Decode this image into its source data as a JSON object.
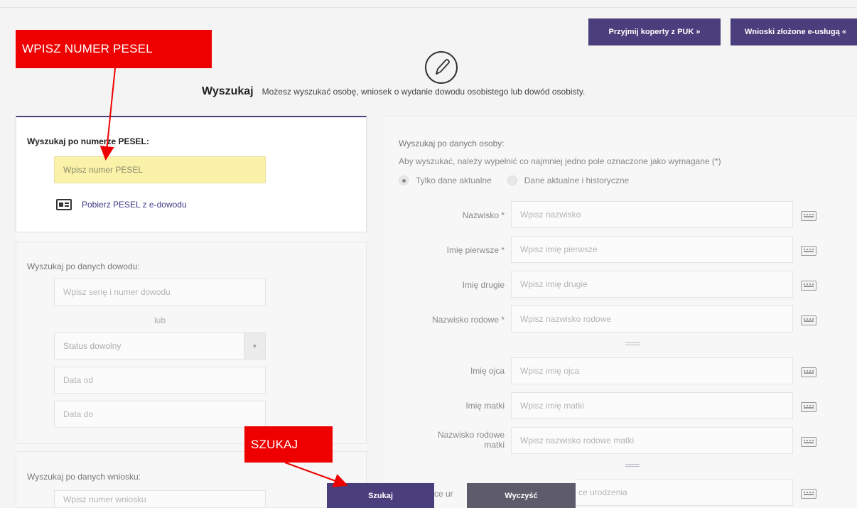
{
  "top_buttons": {
    "puk": "Przyjmij koperty z PUK »",
    "wnioski": "Wnioski złożone e-usługą «"
  },
  "header": {
    "title": "Wyszukaj",
    "description": "Możesz wyszukać osobę, wniosek o wydanie dowodu osobistego lub dowód osobisty."
  },
  "pesel_section": {
    "label": "Wyszukaj po numerze PESEL:",
    "placeholder": "Wpisz numer PESEL",
    "edowod_link": "Pobierz PESEL z e-dowodu"
  },
  "dowod_section": {
    "label": "Wyszukaj po danych dowodu:",
    "series_placeholder": "Wpisz serię i numer dowodu",
    "or_text": "lub",
    "status_value": "Status dowolny",
    "date_from_placeholder": "Data od",
    "date_to_placeholder": "Data do"
  },
  "wniosek_section": {
    "label": "Wyszukaj po danych wniosku:",
    "number_placeholder": "Wpisz numer wniosku"
  },
  "person_section": {
    "title": "Wyszukaj po danych osoby:",
    "hint": "Aby wyszukać, należy wypełnić co najmniej jedno pole oznaczone jako wymagane (*)",
    "radio_current": "Tylko dane aktualne",
    "radio_history": "Dane aktualne i historyczne",
    "fields": [
      {
        "label": "Nazwisko *",
        "placeholder": "Wpisz nazwisko"
      },
      {
        "label": "Imię pierwsze *",
        "placeholder": "Wpisz imię pierwsze"
      },
      {
        "label": "Imię drugie",
        "placeholder": "Wpisz imię drugie"
      },
      {
        "label": "Nazwisko rodowe *",
        "placeholder": "Wpisz nazwisko rodowe"
      },
      {
        "label": "Imię ojca",
        "placeholder": "Wpisz imię ojca"
      },
      {
        "label": "Imię matki",
        "placeholder": "Wpisz imię matki"
      },
      {
        "label": "Nazwisko rodowe matki",
        "placeholder": "Wpisz nazwisko rodowe matki"
      },
      {
        "label": "ce ur",
        "placeholder": "ce urodzenia"
      }
    ]
  },
  "bottom_buttons": {
    "search": "Szukaj",
    "clear": "Wyczyść"
  },
  "annotations": {
    "pesel": "WPISZ NUMER PESEL",
    "szukaj": "SZUKAJ"
  },
  "colors": {
    "accent": "#4b3e7c",
    "highlight_input": "#f9f2a8",
    "annotation": "#ee0000"
  }
}
